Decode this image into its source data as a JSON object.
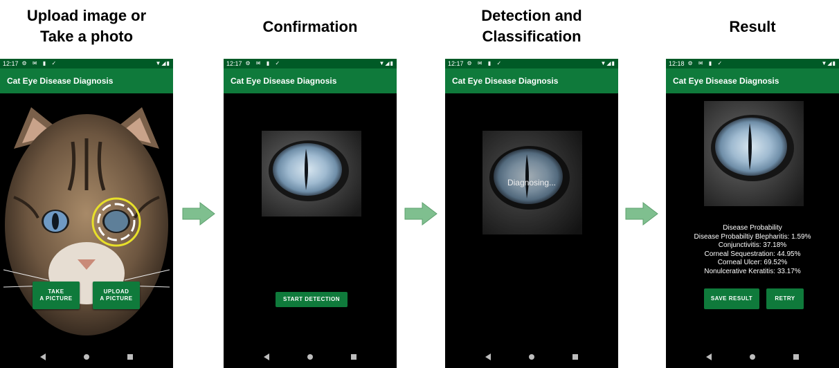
{
  "captions": {
    "step1": [
      "Upload image or",
      "Take a photo"
    ],
    "step2": "Confirmation",
    "step3": [
      "Detection and",
      "Classification"
    ],
    "step4": "Result"
  },
  "app_title": "Cat Eye Disease Diagnosis",
  "screens": [
    {
      "time": "12:17",
      "buttons": {
        "take": "TAKE\nA PICTURE",
        "upload": "UPLOAD\nA PICTURE"
      }
    },
    {
      "time": "12:17",
      "button": "START DETECTION"
    },
    {
      "time": "12:17",
      "overlay": "Diagnosing..."
    },
    {
      "time": "12:18",
      "lines": [
        "Disease Probability",
        "Disease Probabiltiy Blepharitis: 1.59%",
        "Conjunctivitis: 37.18%",
        "Corneal Sequestration: 44.95%",
        "Corneal Ulcer: 69.52%",
        "Nonulcerative Keratitis: 33.17%"
      ],
      "buttons": {
        "save": "SAVE RESULT",
        "retry": "RETRY"
      }
    }
  ],
  "colors": {
    "appbar": "#0f7a3b",
    "statusbar": "#005a26",
    "arrow": "#7fbf8f"
  },
  "status_icons": "⚙ ✉ ▮ ✓",
  "status_right": "▼◢▮"
}
